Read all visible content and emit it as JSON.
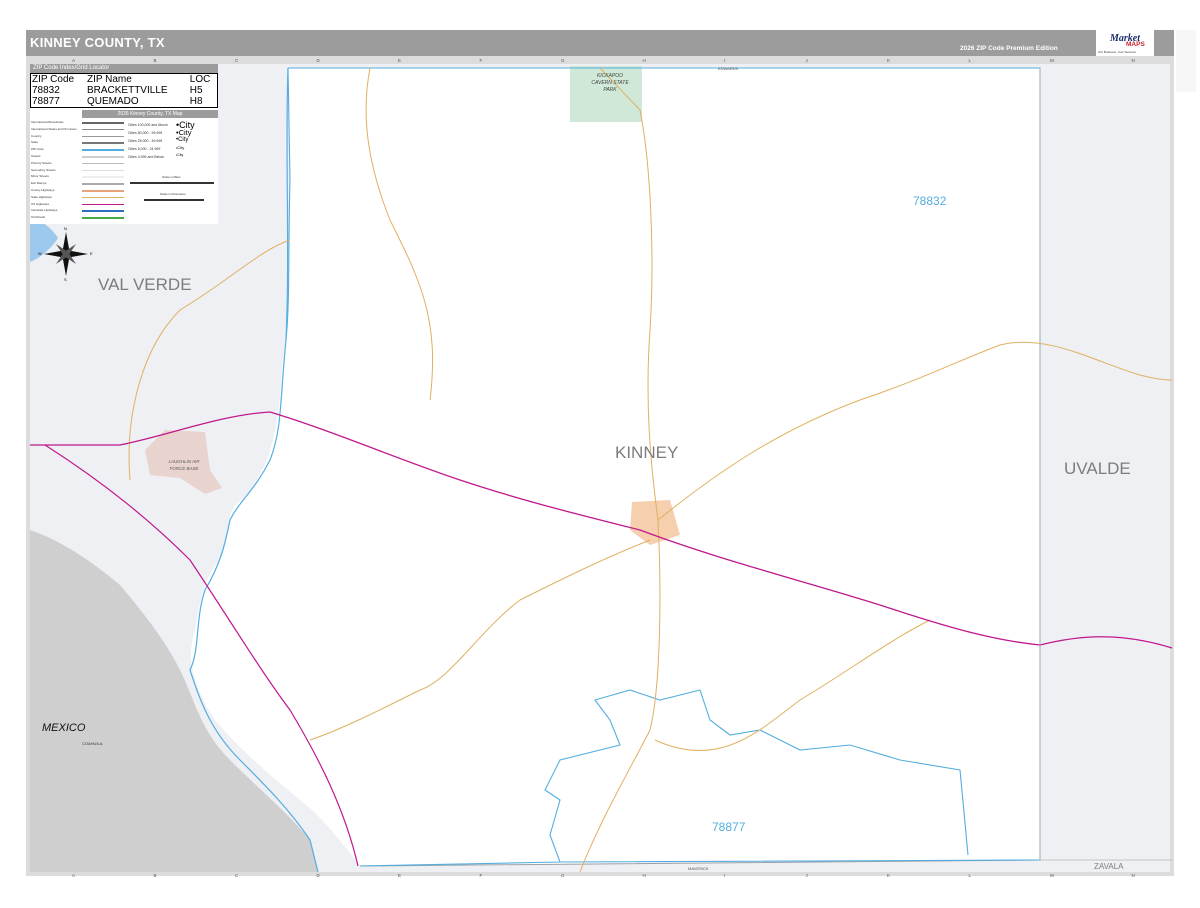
{
  "header": {
    "title": "KINNEY COUNTY, TX",
    "edition": "2026 ZIP Code Premium Edition",
    "logo_market": "Market",
    "logo_maps": "MAPS",
    "logo_tagline": "Our Business, Your Success"
  },
  "map_labels": {
    "county": "KINNEY",
    "neighbors": {
      "west": "VAL VERDE",
      "east": "UVALDE",
      "southeast": "ZAVALA"
    },
    "country": "MEXICO",
    "state_mx": "COAHUILA",
    "park": "KICKAPOO CAVERN STATE PARK",
    "base": "LAUGHLIN AIR FORCE BASE",
    "road_top": "EDWARDS",
    "road_bottom": "MAVERICK",
    "compass": {
      "n": "N",
      "s": "S",
      "e": "E",
      "w": "W"
    }
  },
  "zip_areas": [
    {
      "zip": "78832"
    },
    {
      "zip": "78877"
    }
  ],
  "zip_index": {
    "title": "ZIP Code Index/Grid Locator",
    "headers": [
      "ZIP Code",
      "ZIP Name",
      "LOC"
    ],
    "rows": [
      [
        "78832",
        "BRACKETTVILLE",
        "H5"
      ],
      [
        "78877",
        "QUEMADO",
        "H8"
      ]
    ]
  },
  "legend": {
    "title": "2026 Kinney County, TX Map",
    "items": [
      {
        "label": "International Boundaries",
        "color": "#666666"
      },
      {
        "label": "International States and Provinces",
        "color": "#888888"
      },
      {
        "label": "Country",
        "color": "#999999"
      },
      {
        "label": "State",
        "color": "#777777"
      },
      {
        "label": "ZIP Code",
        "color": "#54aee0"
      },
      {
        "label": "Streets",
        "color": "#cfcfcf"
      },
      {
        "label": "Primary Streets",
        "color": "#bbbbbb"
      },
      {
        "label": "Secondary Streets",
        "color": "#dddddd"
      },
      {
        "label": "Minor Streets",
        "color": "#eeeeee"
      },
      {
        "label": "Exit Ramps",
        "color": "#aaaaaa"
      },
      {
        "label": "County Highways",
        "color": "#e8a27a"
      },
      {
        "label": "State Highways",
        "color": "#e0b060"
      },
      {
        "label": "US Highways",
        "color": "#c0188c"
      },
      {
        "label": "Interstate Highways",
        "color": "#2a6fc0"
      },
      {
        "label": "Toll Roads",
        "color": "#44aa44"
      }
    ],
    "cities": [
      {
        "label": "Cities 100,000 and Above",
        "sample": "City"
      },
      {
        "label": "Cities 50,000 - 99,999",
        "sample": "City"
      },
      {
        "label": "Cities 25,000 - 49,999",
        "sample": "City"
      },
      {
        "label": "Cities 5,000 - 24,999",
        "sample": "City"
      },
      {
        "label": "Cities 4,999 and Below",
        "sample": "City"
      }
    ],
    "scale_miles": "Scale in Miles",
    "scale_km": "Scale in Kilometers"
  },
  "grid": {
    "columns": [
      "A",
      "B",
      "C",
      "D",
      "E",
      "F",
      "G",
      "H",
      "I",
      "J",
      "K",
      "L",
      "M",
      "N"
    ]
  },
  "colors": {
    "title_bar": "#9c9c9c",
    "zip_boundary": "#54aee0",
    "us_highway": "#c0188c",
    "state_highway": "#e0b060",
    "water": "#9ec9ee",
    "outside_county": "#eef0f3",
    "mexico": "#cfcfcf",
    "town": "#f5cfae",
    "base": "#e9d3cf",
    "park": "#cfe8d7"
  }
}
